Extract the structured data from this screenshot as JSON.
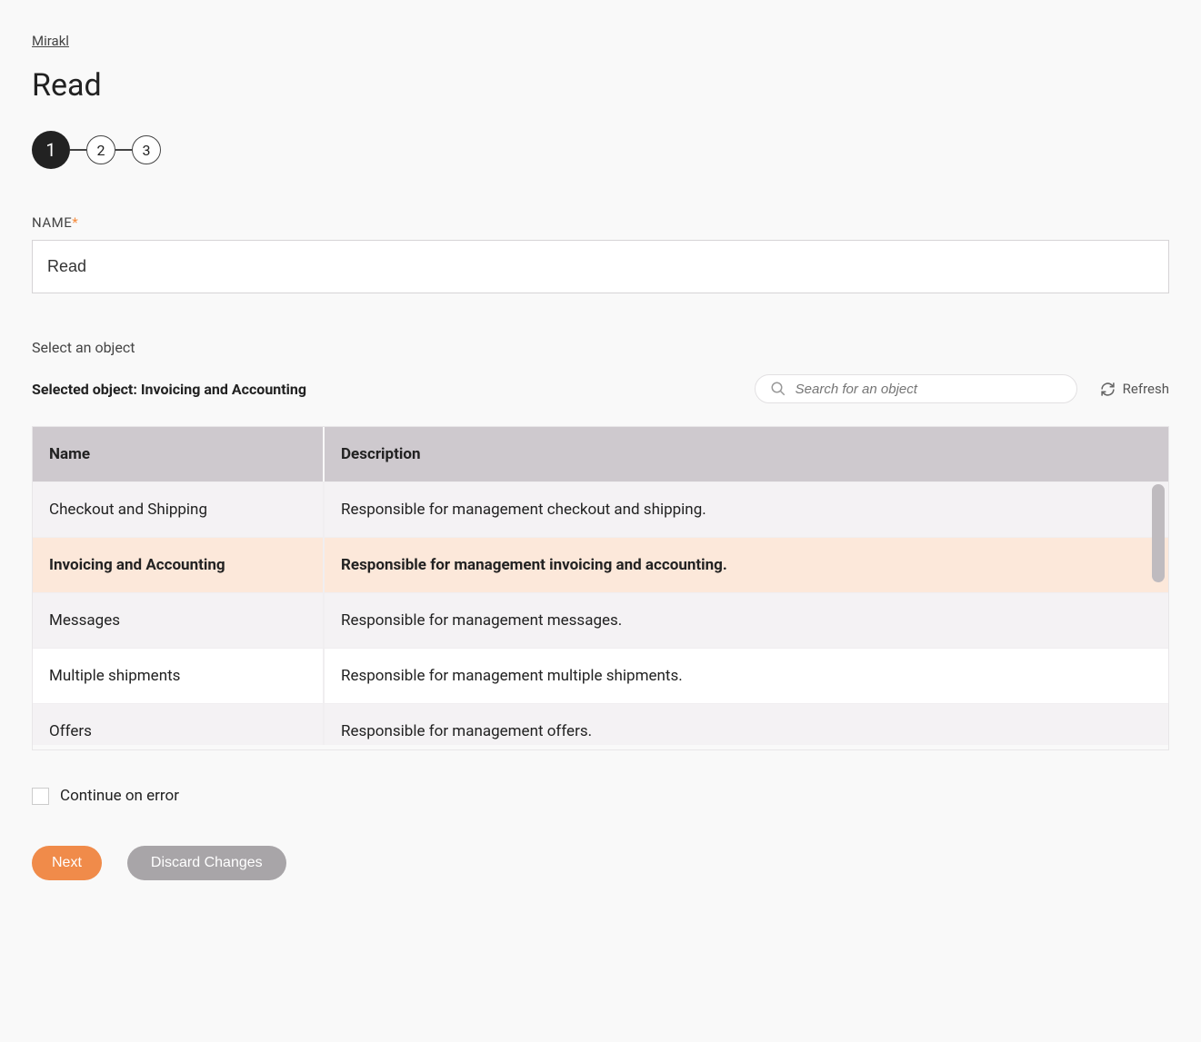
{
  "breadcrumb": {
    "label": "Mirakl"
  },
  "page": {
    "title": "Read"
  },
  "stepper": {
    "steps": [
      "1",
      "2",
      "3"
    ],
    "active_index": 0
  },
  "name_field": {
    "label": "NAME",
    "value": "Read"
  },
  "object_section": {
    "prompt": "Select an object",
    "selected_label": "Selected object: Invoicing and Accounting",
    "search_placeholder": "Search for an object",
    "refresh_label": "Refresh"
  },
  "table": {
    "headers": {
      "name": "Name",
      "description": "Description"
    },
    "rows": [
      {
        "name": "Checkout and Shipping",
        "description": "Responsible for management checkout and shipping.",
        "selected": false
      },
      {
        "name": "Invoicing and Accounting",
        "description": "Responsible for management invoicing and accounting.",
        "selected": true
      },
      {
        "name": "Messages",
        "description": "Responsible for management messages.",
        "selected": false
      },
      {
        "name": "Multiple shipments",
        "description": "Responsible for management multiple shipments.",
        "selected": false
      },
      {
        "name": "Offers",
        "description": "Responsible for management offers.",
        "selected": false
      }
    ]
  },
  "continue_on_error": {
    "label": "Continue on error",
    "checked": false
  },
  "buttons": {
    "next": "Next",
    "discard": "Discard Changes"
  }
}
